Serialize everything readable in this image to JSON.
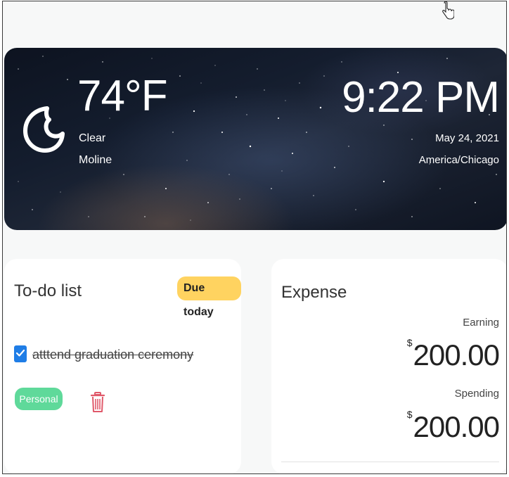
{
  "weather": {
    "temperature": "74°F",
    "condition": "Clear",
    "city": "Moline",
    "icon": "moon-icon"
  },
  "clock": {
    "time": "9:22 PM",
    "date": "May 24, 2021",
    "timezone": "America/Chicago"
  },
  "todo": {
    "title": "To-do list",
    "badge": "Due today",
    "items": [
      {
        "text": "atttend graduation ceremony",
        "checked": true,
        "tag": "Personal"
      }
    ]
  },
  "expense": {
    "title": "Expense",
    "earning_label": "Earning",
    "earning_currency": "$",
    "earning_value": "200.00",
    "spending_label": "Spending",
    "spending_currency": "$",
    "spending_value": "200.00"
  },
  "colors": {
    "badge": "#ffd360",
    "tag": "#5fd99a",
    "checkbox": "#1f7de6",
    "trash": "#e0596a"
  }
}
